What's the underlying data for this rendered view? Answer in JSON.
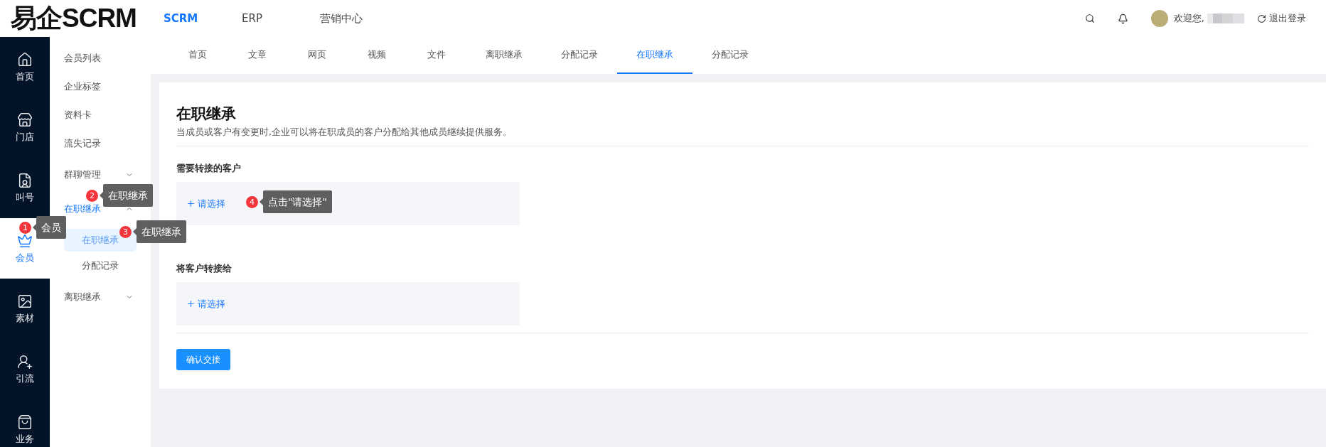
{
  "header": {
    "logo": "易企SCRM",
    "nav": [
      {
        "label": "SCRM",
        "selected": true
      },
      {
        "label": "ERP",
        "selected": false
      },
      {
        "label": "营销中心",
        "selected": false
      }
    ],
    "welcome": "欢迎您,",
    "logout": "退出登录"
  },
  "rail": [
    {
      "label": "首页",
      "selected": false
    },
    {
      "label": "门店",
      "selected": false
    },
    {
      "label": "叫号",
      "selected": false
    },
    {
      "label": "会员",
      "selected": true
    },
    {
      "label": "素材",
      "selected": false
    },
    {
      "label": "引流",
      "selected": false
    },
    {
      "label": "业务",
      "selected": false
    }
  ],
  "submenu": [
    {
      "label": "会员列表",
      "selected": false
    },
    {
      "label": "企业标签",
      "selected": false
    },
    {
      "label": "资料卡",
      "selected": false
    },
    {
      "label": "流失记录",
      "selected": false
    },
    {
      "label": "群聊管理",
      "selected": false,
      "expanded": false
    },
    {
      "label": "在职继承",
      "selected": true,
      "expanded": true,
      "children": [
        {
          "label": "在职继承",
          "selected": true
        },
        {
          "label": "分配记录",
          "selected": false
        }
      ]
    },
    {
      "label": "离职继承",
      "selected": false,
      "expanded": false
    }
  ],
  "tabs": [
    {
      "label": "首页",
      "selected": false
    },
    {
      "label": "文章",
      "selected": false
    },
    {
      "label": "网页",
      "selected": false
    },
    {
      "label": "视频",
      "selected": false
    },
    {
      "label": "文件",
      "selected": false
    },
    {
      "label": "离职继承",
      "selected": false
    },
    {
      "label": "分配记录",
      "selected": false
    },
    {
      "label": "在职继承",
      "selected": true
    },
    {
      "label": "分配记录",
      "selected": false
    }
  ],
  "page": {
    "title": "在职继承",
    "description": "当成员或客户有变更时,企业可以将在职成员的客户分配给其他成员继续提供服务。",
    "sections": [
      {
        "label": "需要转接的客户",
        "action": "请选择"
      },
      {
        "label": "将客户转接给",
        "action": "请选择"
      }
    ],
    "button": "确认交接"
  },
  "annotations": [
    {
      "number": "1",
      "text": "会员"
    },
    {
      "number": "2",
      "text": "在职继承"
    },
    {
      "number": "3",
      "text": "在职继承"
    },
    {
      "number": "4",
      "text": "点击\"请选择\""
    }
  ]
}
